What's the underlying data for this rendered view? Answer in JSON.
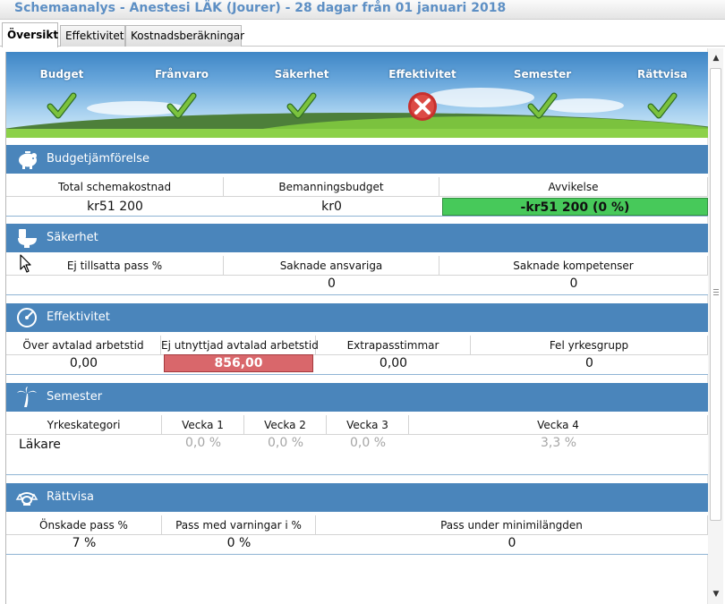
{
  "window": {
    "title": "Schemaanalys - Anestesi LÄK (Jourer) - 28 dagar från 01 januari 2018"
  },
  "tabs": [
    {
      "label": "Översikt",
      "active": true
    },
    {
      "label": "Effektivitet",
      "active": false
    },
    {
      "label": "Kostnadsberäkningar",
      "active": false
    }
  ],
  "status": [
    {
      "label": "Budget",
      "state": "ok",
      "icon": "check-icon"
    },
    {
      "label": "Frånvaro",
      "state": "ok",
      "icon": "check-icon"
    },
    {
      "label": "Säkerhet",
      "state": "ok",
      "icon": "check-icon"
    },
    {
      "label": "Effektivitet",
      "state": "fail",
      "icon": "x-circle-icon"
    },
    {
      "label": "Semester",
      "state": "ok",
      "icon": "check-icon"
    },
    {
      "label": "Rättvisa",
      "state": "ok",
      "icon": "check-icon"
    }
  ],
  "budget": {
    "title": "Budgetjämförelse",
    "icon": "piggy-bank-icon",
    "headers": [
      "Total schemakostnad",
      "Bemanningsbudget",
      "Avvikelse"
    ],
    "values": [
      "kr51 200",
      "kr0",
      "-kr51 200 (0 %)"
    ]
  },
  "security": {
    "title": "Säkerhet",
    "icon": "toilet-icon",
    "headers": [
      "Ej tillsatta pass %",
      "Saknade ansvariga",
      "Saknade kompetenser"
    ],
    "values": [
      "",
      "0",
      "0"
    ]
  },
  "efficiency": {
    "title": "Effektivitet",
    "icon": "speedometer-icon",
    "headers": [
      "Över avtalad arbetstid",
      "Ej utnyttjad avtalad arbetstid",
      "Extrapasstimmar",
      "Fel yrkesgrupp"
    ],
    "values": [
      "0,00",
      "856,00",
      "0,00",
      "0"
    ]
  },
  "vacation": {
    "title": "Semester",
    "icon": "palm-tree-icon",
    "headers": [
      "Yrkeskategori",
      "Vecka 1",
      "Vecka 2",
      "Vecka 3",
      "Vecka 4"
    ],
    "rows": [
      {
        "category": "Läkare",
        "weeks": [
          "0,0 %",
          "0,0 %",
          "0,0 %",
          "3,3 %"
        ]
      }
    ]
  },
  "fairness": {
    "title": "Rättvisa",
    "icon": "scales-icon",
    "headers": [
      "Önskade pass %",
      "Pass med varningar i %",
      "Pass under minimilängden"
    ],
    "values": [
      "7 %",
      "0 %",
      "0"
    ]
  },
  "colors": {
    "header_blue": "#4a85bb",
    "title_blue": "#5d8fc4",
    "ok_green": "#47c95a",
    "fail_red": "#d9676b",
    "check_green": "#7bc23e"
  }
}
